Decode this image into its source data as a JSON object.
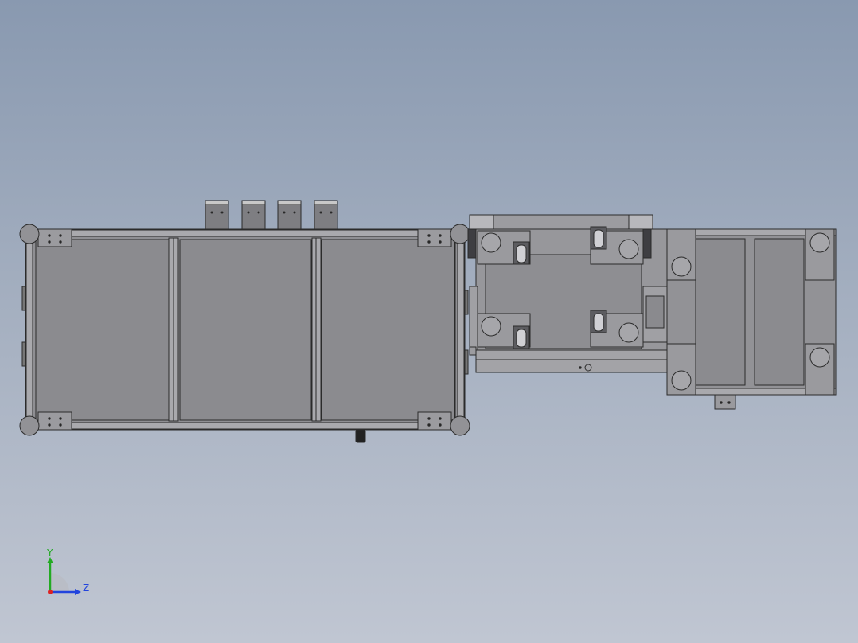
{
  "viewport": {
    "background_top": "#8999b0",
    "background_bottom": "#c0c6d2"
  },
  "model": {
    "part_fill": "#8f8f93",
    "panel_fill": "#8b8b8f",
    "edge_color": "#2b2b2b",
    "highlight": "#c8c8c8"
  },
  "triad": {
    "y_label": "Y",
    "z_label": "Z",
    "y_color": "#22aa22",
    "z_color": "#2244dd",
    "x_color": "#dd2222"
  }
}
